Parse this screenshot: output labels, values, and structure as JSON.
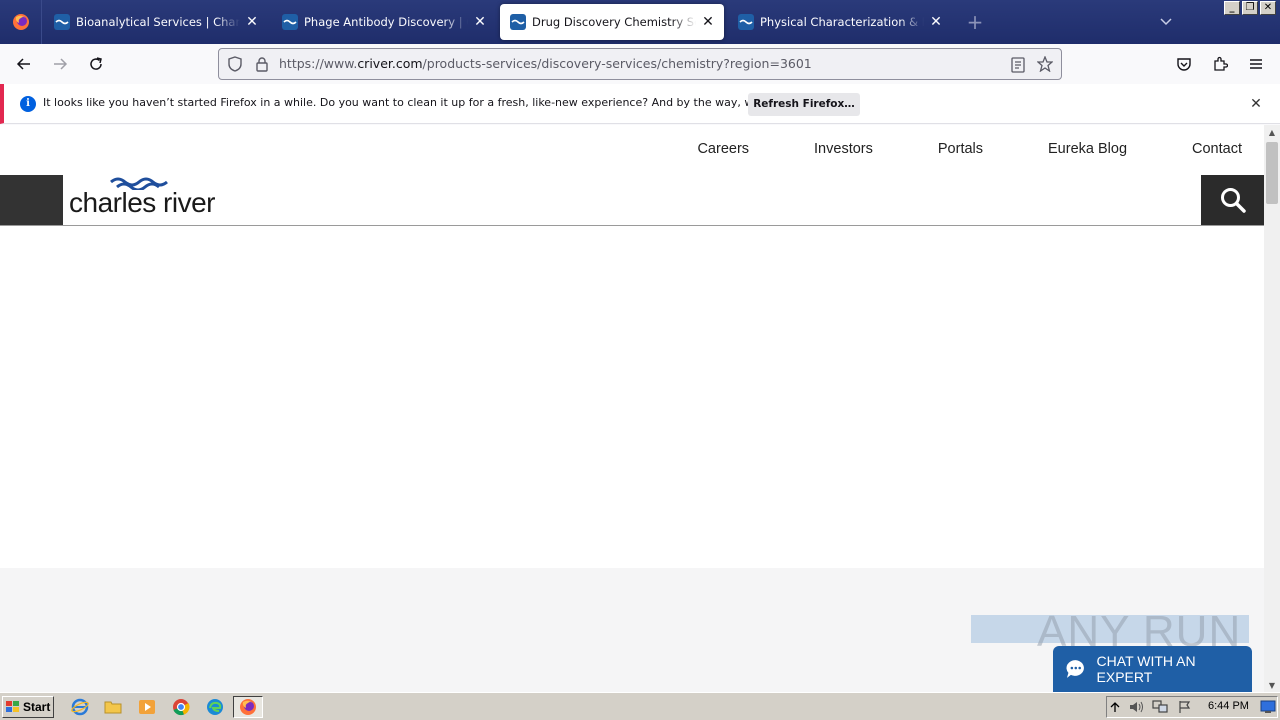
{
  "browser": {
    "tabs": [
      {
        "title": "Bioanalytical Services | Charles River",
        "active": false
      },
      {
        "title": "Phage Antibody Discovery | Charles River",
        "active": false
      },
      {
        "title": "Drug Discovery Chemistry Services",
        "active": true
      },
      {
        "title": "Physical Characterization & Pharmaceutics",
        "active": false
      }
    ],
    "url_prefix": "https://www.",
    "url_host": "criver.com",
    "url_path": "/products-services/discovery-services/chemistry?region=3601",
    "window_buttons": [
      "_",
      "❐",
      "✕"
    ]
  },
  "notification": {
    "icon": "i",
    "text": "It looks like you haven’t started Firefox in a while. Do you want to clean it up for a fresh, like-new experience? And by the way, welcome back!",
    "button_label": "Refresh Firefox…"
  },
  "site": {
    "top_nav": [
      "Careers",
      "Investors",
      "Portals",
      "Eureka Blog",
      "Contact"
    ],
    "logo_text": "charles river",
    "chat_label": "CHAT WITH AN EXPERT",
    "watermark": "ANY RUN"
  },
  "taskbar": {
    "start_label": "Start",
    "clock": "6:44 PM"
  },
  "colors": {
    "tabstrip": "#1f2d6b",
    "notif_accent": "#e22850",
    "chat_button": "#1f5fa6",
    "header_dark": "#333333",
    "logo_wave": "#1f4e9c"
  }
}
